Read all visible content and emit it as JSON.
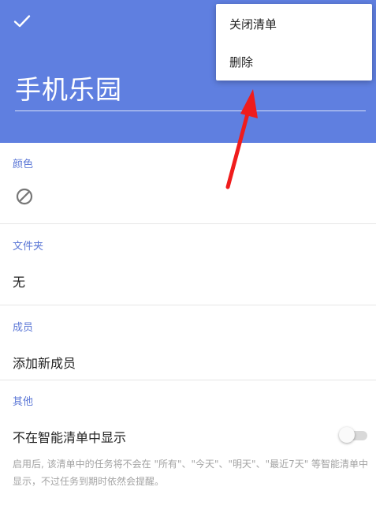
{
  "header": {
    "confirm_icon": "check-icon",
    "title": "手机乐园",
    "background_color": "#5f7fe0"
  },
  "menu": {
    "items": [
      {
        "label": "关闭清单"
      },
      {
        "label": "删除"
      }
    ]
  },
  "sections": {
    "color": {
      "label": "颜色",
      "value_icon": "ban-icon"
    },
    "folder": {
      "label": "文件夹",
      "value": "无"
    },
    "members": {
      "label": "成员",
      "value": "添加新成员"
    },
    "other": {
      "label": "其他",
      "toggle_label": "不在智能清单中显示",
      "toggle_on": false,
      "description": "启用后, 该清单中的任务将不会在 \"所有\"、\"今天\"、\"明天\"、\"最近7天\" 等智能清单中显示，不过任务到期时依然会提醒。"
    }
  },
  "annotation": {
    "type": "arrow",
    "color": "#f01c1c"
  },
  "accent_color": "#5b77d6"
}
